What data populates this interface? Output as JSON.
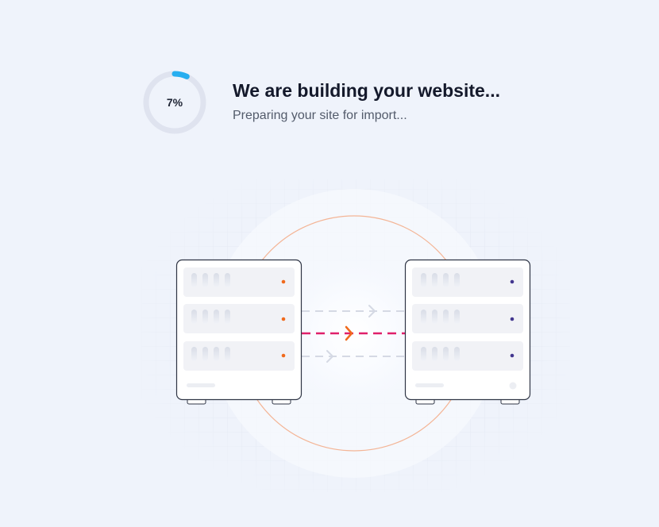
{
  "progress": {
    "percent_label": "7%",
    "value": 7,
    "ring_color": "#27aef0",
    "track_color": "#dfe3ef"
  },
  "heading": {
    "title": "We are building your website...",
    "subtitle": "Preparing your site for import..."
  },
  "illustration": {
    "source_server_led_color": "#f06a1d",
    "target_server_led_color": "#43378f",
    "active_transfer_color": "#e0206a",
    "active_arrow_color": "#f06a1d",
    "idle_transfer_color": "#d5d9e4",
    "orbit_color": "#f4b596"
  }
}
